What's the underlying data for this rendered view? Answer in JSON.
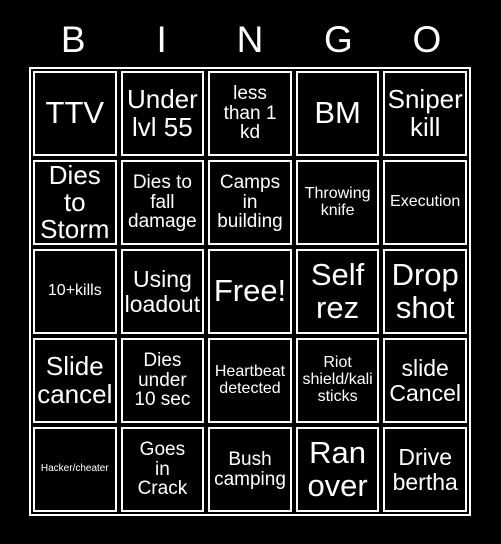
{
  "card": {
    "title_letters": [
      "B",
      "I",
      "N",
      "G",
      "O"
    ],
    "background_color": "#000000",
    "border_color": "#ffffff",
    "text_color": "#ffffff",
    "rows": 5,
    "columns": 5,
    "cells": [
      {
        "text": "TTV",
        "size": "fs-xxl"
      },
      {
        "text": "Under\nlvl 55",
        "size": "fs-xl"
      },
      {
        "text": "less\nthan 1\nkd",
        "size": "fs-m"
      },
      {
        "text": "BM",
        "size": "fs-xxl"
      },
      {
        "text": "Sniper\nkill",
        "size": "fs-xl"
      },
      {
        "text": "Dies to\nStorm",
        "size": "fs-xl"
      },
      {
        "text": "Dies to\nfall\ndamage",
        "size": "fs-m"
      },
      {
        "text": "Camps\nin\nbuilding",
        "size": "fs-m"
      },
      {
        "text": "Throwing\nknife",
        "size": "fs-s"
      },
      {
        "text": "Execution",
        "size": "fs-s"
      },
      {
        "text": "10+kills",
        "size": "fs-s"
      },
      {
        "text": "Using\nloadout",
        "size": "fs-l"
      },
      {
        "text": "Free!",
        "size": "fs-xxl"
      },
      {
        "text": "Self\nrez",
        "size": "fs-xxl"
      },
      {
        "text": "Drop\nshot",
        "size": "fs-xxl"
      },
      {
        "text": "Slide\ncancel",
        "size": "fs-xl"
      },
      {
        "text": "Dies\nunder\n10 sec",
        "size": "fs-m"
      },
      {
        "text": "Heartbeat\ndetected",
        "size": "fs-s"
      },
      {
        "text": "Riot\nshield/kali\nsticks",
        "size": "fs-s"
      },
      {
        "text": "slide\nCancel",
        "size": "fs-l"
      },
      {
        "text": "Hacker/cheater",
        "size": "fs-xs"
      },
      {
        "text": "Goes\nin\nCrack",
        "size": "fs-m"
      },
      {
        "text": "Bush\ncamping",
        "size": "fs-m"
      },
      {
        "text": "Ran\nover",
        "size": "fs-xxl"
      },
      {
        "text": "Drive\nbertha",
        "size": "fs-l"
      }
    ]
  }
}
